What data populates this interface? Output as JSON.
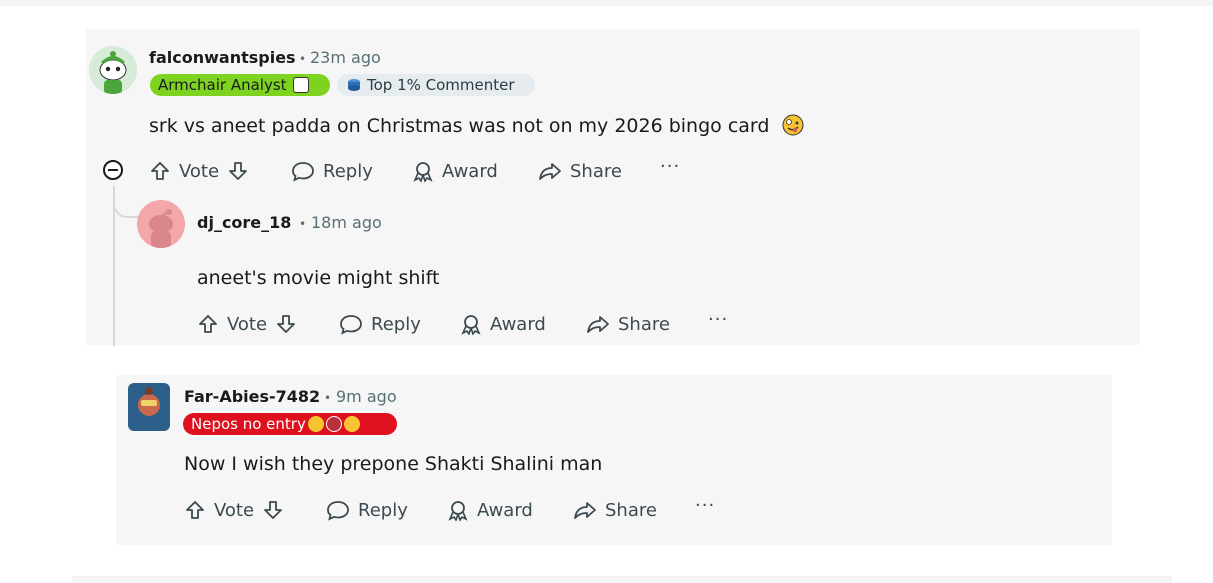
{
  "comments": [
    {
      "username": "falconwantspies",
      "time": "23m ago",
      "flairs": [
        {
          "text": "Armchair Analyst",
          "color": "#7ed321",
          "icon": "armchair-flair-icon"
        },
        {
          "text": "Top 1% Commenter",
          "color": "#e5ebee",
          "icon": "top-commenter-icon"
        }
      ],
      "body": "srk vs aneet padda on Christmas was not on my 2026 bingo card",
      "body_emoji": "zany-face-emoji",
      "avatar": "reddit-snoo-green-avatar",
      "actions": {
        "vote": "Vote",
        "reply": "Reply",
        "award": "Award",
        "share": "Share",
        "more": "···"
      }
    },
    {
      "username": "dj_core_18",
      "time": "18m ago",
      "body": "aneet's movie might shift",
      "avatar": "reddit-snoo-pink-avatar",
      "actions": {
        "vote": "Vote",
        "reply": "Reply",
        "award": "Award",
        "share": "Share",
        "more": "···"
      }
    },
    {
      "username": "Far-Abies-7482",
      "time": "9m ago",
      "flairs": [
        {
          "text": "Nepos no entry",
          "color": "#e0111f",
          "icons": [
            "hot-face-emoji",
            "angry-devil-emoji",
            "confounded-face-emoji"
          ]
        }
      ],
      "body": "Now I wish they prepone Shakti Shalini man",
      "avatar": "reddit-snoo-custom-avatar",
      "actions": {
        "vote": "Vote",
        "reply": "Reply",
        "award": "Award",
        "share": "Share",
        "more": "···"
      }
    }
  ],
  "separator": "•",
  "colors": {
    "panel": "#f6f6f6",
    "text": "#1a1a1b",
    "meta": "#576f76",
    "action": "#3b4a50",
    "thread": "#d7dadc"
  }
}
